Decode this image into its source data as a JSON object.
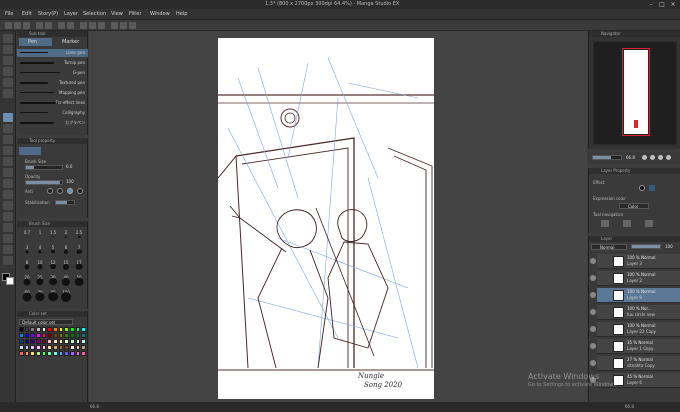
{
  "window": {
    "title": "1.3* (800 x 2700px 300dpi 64.4%) - Manga Studio EX"
  },
  "menu": [
    "File",
    "Edit",
    "Story(P)",
    "Layer",
    "Selection",
    "View",
    "Filter",
    "Window",
    "Help"
  ],
  "subtool": {
    "header": "Sub tool",
    "tabs": [
      "Pen",
      "Marker"
    ],
    "brushes": [
      "Liner pen",
      "Turnip pen",
      "G-pen",
      "Textured pen",
      "Mapping pen",
      "For effect lines",
      "Calligraphy",
      "カブラペン"
    ]
  },
  "tool_property": {
    "header": "Tool property",
    "brush_size_label": "Brush Size",
    "brush_size_value": "6.0",
    "opacity_label": "Opacity",
    "opacity_value": "100",
    "aa_label": "Anti",
    "stabilization_label": "Stabilization",
    "opacity_fraction": 0.95,
    "size_fraction": 0.22
  },
  "brush_size": {
    "header": "Brush Size",
    "sizes": [
      "0.7",
      "1",
      "1.5",
      "2",
      "2.5",
      "3",
      "4",
      "5",
      "6",
      "7",
      "8",
      "10",
      "12",
      "15",
      "17",
      "20",
      "25",
      "30",
      "40",
      "50",
      "60",
      "70",
      "80",
      "100"
    ]
  },
  "color_set": {
    "header": "Color set",
    "set_name": "Default color set",
    "colors": [
      "#000000",
      "#404040",
      "#808080",
      "#c0c0c0",
      "#ffffff",
      "#ff0000",
      "#ff8000",
      "#ffff00",
      "#80ff00",
      "#00ff00",
      "#00ff80",
      "#00ffff",
      "#0080ff",
      "#0000ff",
      "#8000ff",
      "#ff00ff",
      "#ff0080",
      "#800000",
      "#804000",
      "#808000",
      "#408000",
      "#008000",
      "#008040",
      "#008080",
      "#004080",
      "#000080",
      "#400080",
      "#800080",
      "#800040",
      "#ffc0c0",
      "#ffe0c0",
      "#ffffc0",
      "#e0ffc0",
      "#c0ffc0",
      "#c0ffe0",
      "#c0ffff",
      "#c0e0ff",
      "#c0c0ff",
      "#e0c0ff",
      "#ffc0ff",
      "#ffc0e0",
      "#f0d8b0",
      "#d8a878",
      "#a87048",
      "#704020",
      "#ffe8d8",
      "#e8c8b0",
      "#c89878",
      "#ff6060",
      "#ffa060",
      "#ffe060",
      "#a0ff60",
      "#60ff60",
      "#60ffa0",
      "#60ffff",
      "#60a0ff",
      "#6060ff",
      "#a060ff",
      "#ff60ff",
      "#ff60a0"
    ]
  },
  "navigator": {
    "header": "Navigator",
    "zoom": "66.8",
    "angle": "0.0"
  },
  "layer_property": {
    "header": "Layer Property",
    "effect_label": "Effect",
    "expression_label": "Expression color",
    "expression_value": "Color",
    "tool_nav_label": "Tool navigation"
  },
  "layer_panel": {
    "header": "Layer",
    "blend_mode": "Normal",
    "opacity": "100",
    "layers": [
      {
        "op": "100 %  Normal",
        "name": "Layer 3"
      },
      {
        "op": "100 %  Normal",
        "name": "Layer 2"
      },
      {
        "op": "100 %  Normal",
        "name": "Layer 9"
      },
      {
        "op": "100 %  Nor...",
        "name": "fuu circle new"
      },
      {
        "op": "100 %  Normal",
        "name": "Layer 22 Copy"
      },
      {
        "op": "35 %  Normal",
        "name": "Layer 1 Copy"
      },
      {
        "op": "27 %  Normal",
        "name": "sitnahta Copy"
      },
      {
        "op": "45 %  Normal",
        "name": "Layer 6"
      }
    ]
  },
  "status": {
    "zoom_left": "66.8",
    "zoom_right": "66.8"
  },
  "watermark": {
    "line1": "Activate Windows",
    "line2": "Go to Settings to activate Windows."
  },
  "signature": "Nungle\nSong 2020"
}
